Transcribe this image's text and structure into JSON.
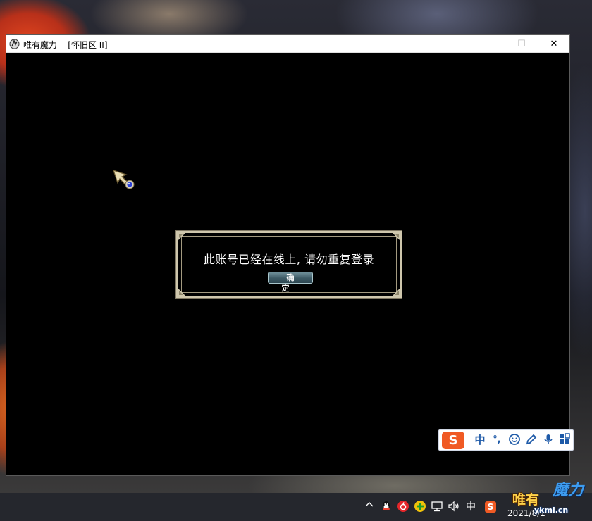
{
  "window": {
    "title": "唯有魔力    [怀旧区 II]",
    "controls": {
      "minimize": "—",
      "maximize": "☐",
      "close": "✕"
    }
  },
  "dialog": {
    "message": "此账号已经在线上, 请勿重复登录",
    "confirm_label": "确定"
  },
  "ime_toolbar": {
    "logo": "S",
    "mode": "中",
    "punctuation": "°,",
    "items": [
      "emoji-icon",
      "pen-icon",
      "microphone-icon",
      "grid-icon"
    ]
  },
  "taskbar": {
    "tray_icons": [
      "chevron-up-icon",
      "qq-icon",
      "netease-music-icon",
      "add-icon",
      "network-icon",
      "volume-icon"
    ],
    "ime_indicator": "中",
    "sogou_icon": "S",
    "date": "2021/8/1"
  },
  "watermark": {
    "text_left": "唯有",
    "text_right": "魔力",
    "url": "ykml.cn"
  },
  "colors": {
    "dialog_border": "#cfc7ad",
    "button_bg": "#3d5a65",
    "ime_logo": "#f05a24",
    "ime_icon": "#1e5aa8",
    "taskbar": "#25272d"
  }
}
